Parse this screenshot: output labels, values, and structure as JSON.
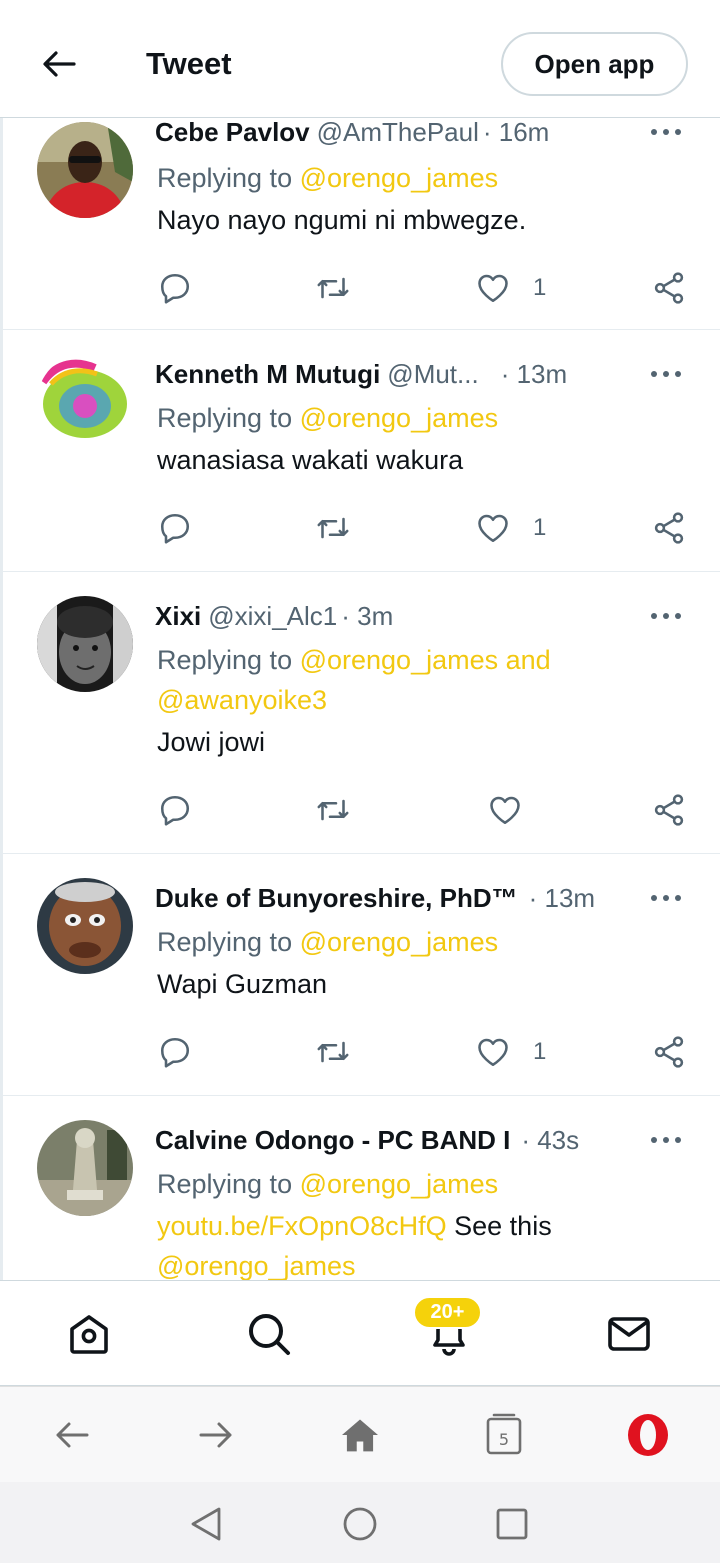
{
  "header": {
    "title": "Tweet",
    "open_app_label": "Open app"
  },
  "colors": {
    "mention": "#f2c811",
    "badge": "#f5d20b",
    "text_primary": "#0f1419",
    "text_secondary": "#536471",
    "opera_red": "#e0121f"
  },
  "tweets": [
    {
      "name": "Cebe Pavlov",
      "handle": "@AmThePaul",
      "time": "· 16m",
      "replying_prefix": "Replying to ",
      "replying_to": "@orengo_james",
      "text": "Nayo nayo ngumi ni mbwegze.",
      "like_count": "1"
    },
    {
      "name": "Kenneth M Mutugi",
      "handle": "@Mut...",
      "time": "· 13m",
      "replying_prefix": "Replying to ",
      "replying_to": "@orengo_james",
      "text": "wanasiasa wakati wakura",
      "like_count": "1"
    },
    {
      "name": "Xixi",
      "handle": "@xixi_Alc1",
      "time": "· 3m",
      "replying_prefix": "Replying to ",
      "replying_to": "@orengo_james and",
      "replying_to_line2": "@awanyoike3",
      "text": "Jowi jowi",
      "like_count": ""
    },
    {
      "name": "Duke of Bunyoreshire, PhD™",
      "handle": "",
      "time": "· 13m",
      "replying_prefix": "Replying to ",
      "replying_to": "@orengo_james",
      "text": "Wapi Guzman",
      "like_count": "1"
    },
    {
      "name": "Calvine Odongo - PC BAND I",
      "handle": "",
      "time": "· 43s",
      "replying_prefix": "Replying to ",
      "replying_to": "@orengo_james",
      "link": "youtu.be/FxOpnO8cHfQ",
      "text_after_link": " See this",
      "mention_line3": "@orengo_james"
    }
  ],
  "bottom_nav": {
    "notifications_badge": "20+"
  },
  "browser_bar": {
    "tab_count": "5"
  }
}
